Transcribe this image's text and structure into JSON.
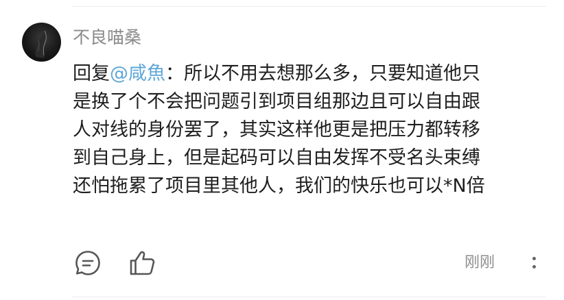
{
  "comment": {
    "username": "不良喵桑",
    "reply_prefix": "回复",
    "mention": "@咸魚",
    "line1_rest": "：所以不用去想那么多，只要知道他只",
    "lines": [
      "是换了个不会把问题引到项目组那边且可以自由跟",
      "人对线的身份罢了，其实这样他更是把压力都转移",
      "到自己身上，但是起码可以自由发挥不受名头束缚",
      "还怕拖累了项目里其他人，我们的快乐也可以*N倍"
    ],
    "timestamp": "刚刚"
  },
  "icons": {
    "avatar": "user-avatar",
    "comment": "comment-bubble-icon",
    "like": "thumbs-up-icon",
    "more": "more-vertical-icon"
  },
  "colors": {
    "mention": "#5fa7d8",
    "username": "#8a8a8a",
    "text": "#1e1e1e"
  }
}
